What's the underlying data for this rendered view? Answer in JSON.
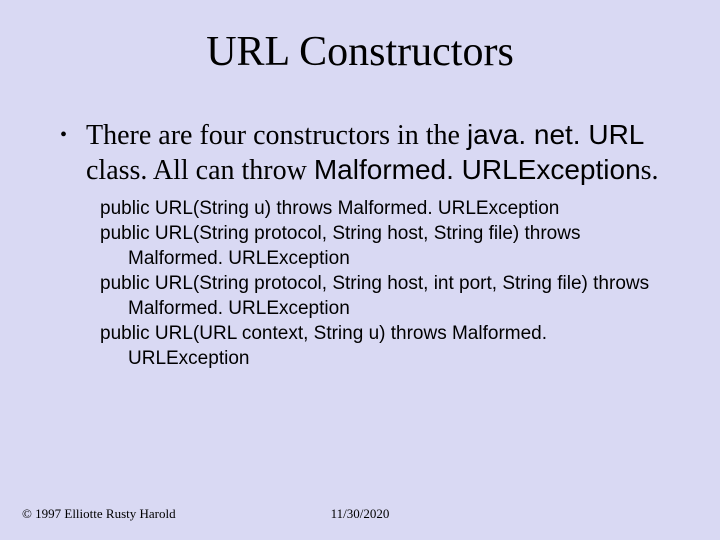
{
  "title": "URL Constructors",
  "bullet": {
    "pre": "There are four constructors in the ",
    "code1": "java. net. URL",
    "mid": " class. All can throw ",
    "code2": "Malformed. URLException",
    "post": "s."
  },
  "signatures": [
    "public URL(String u) throws Malformed. URLException",
    "public URL(String protocol, String host, String file) throws Malformed. URLException",
    "public URL(String protocol, String host, int port, String file) throws Malformed. URLException",
    "public URL(URL context, String u) throws Malformed. URLException"
  ],
  "footer": {
    "copyright": "© 1997 Elliotte Rusty Harold",
    "date": "11/30/2020"
  }
}
